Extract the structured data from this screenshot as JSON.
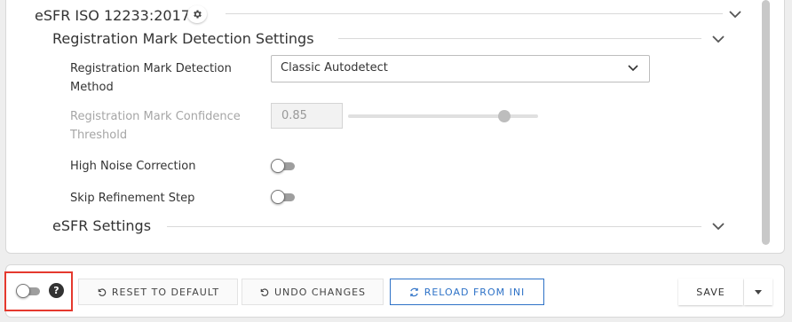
{
  "esfr_section": {
    "title": "eSFR ISO 12233:2017",
    "icon": "gear-icon"
  },
  "reg_section": {
    "title": "Registration Mark Detection Settings",
    "method_label": "Registration Mark Detection Method",
    "method_value": "Classic Autodetect",
    "confidence_label": "Registration Mark Confidence Threshold",
    "confidence_value": "0.85",
    "confidence_slider_fraction": 0.82,
    "high_noise_label": "High Noise Correction",
    "high_noise_on": false,
    "skip_refine_label": "Skip Refinement Step",
    "skip_refine_on": false
  },
  "esfr_settings": {
    "title": "eSFR Settings"
  },
  "footer": {
    "toggle_on": false,
    "help_glyph": "?",
    "reset_label": "RESET TO DEFAULT",
    "undo_label": "UNDO CHANGES",
    "reload_label": "RELOAD FROM INI",
    "save_label": "SAVE"
  },
  "colors": {
    "accent": "#2e72c7",
    "highlight": "#e5392e"
  }
}
